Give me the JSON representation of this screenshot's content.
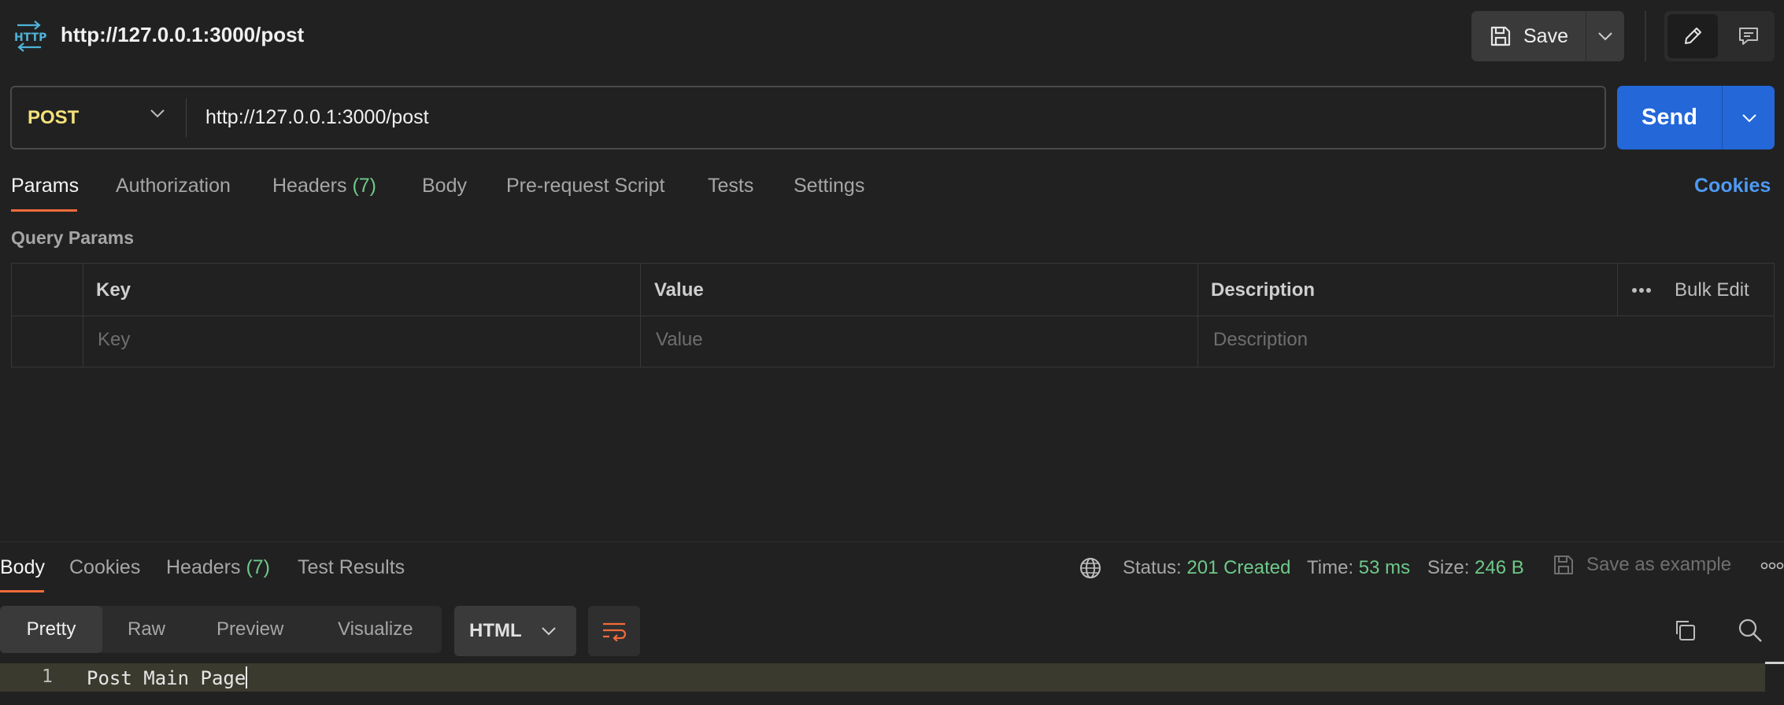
{
  "header": {
    "title": "http://127.0.0.1:3000/post",
    "save_label": "Save"
  },
  "request": {
    "method": "POST",
    "url": "http://127.0.0.1:3000/post",
    "send_label": "Send"
  },
  "request_tabs": {
    "params": "Params",
    "authorization": "Authorization",
    "headers": "Headers",
    "headers_count": "(7)",
    "body": "Body",
    "prerequest": "Pre-request Script",
    "tests": "Tests",
    "settings": "Settings",
    "cookies": "Cookies"
  },
  "query_params": {
    "title": "Query Params",
    "columns": [
      "Key",
      "Value",
      "Description"
    ],
    "placeholders": [
      "Key",
      "Value",
      "Description"
    ],
    "bulk_edit": "Bulk Edit"
  },
  "response": {
    "tabs": {
      "body": "Body",
      "cookies": "Cookies",
      "headers": "Headers",
      "headers_count": "(7)",
      "test_results": "Test Results"
    },
    "status_label": "Status:",
    "status_value": "201 Created",
    "time_label": "Time:",
    "time_value": "53 ms",
    "size_label": "Size:",
    "size_value": "246 B",
    "save_example": "Save as example",
    "views": [
      "Pretty",
      "Raw",
      "Preview",
      "Visualize"
    ],
    "format": "HTML",
    "code": {
      "line_number": "1",
      "text": "Post Main Page"
    }
  },
  "colors": {
    "accent": "#f26b3a",
    "method": "#f4e27a",
    "send": "#2367d8",
    "success": "#6ec98a",
    "link": "#4d9af5"
  }
}
